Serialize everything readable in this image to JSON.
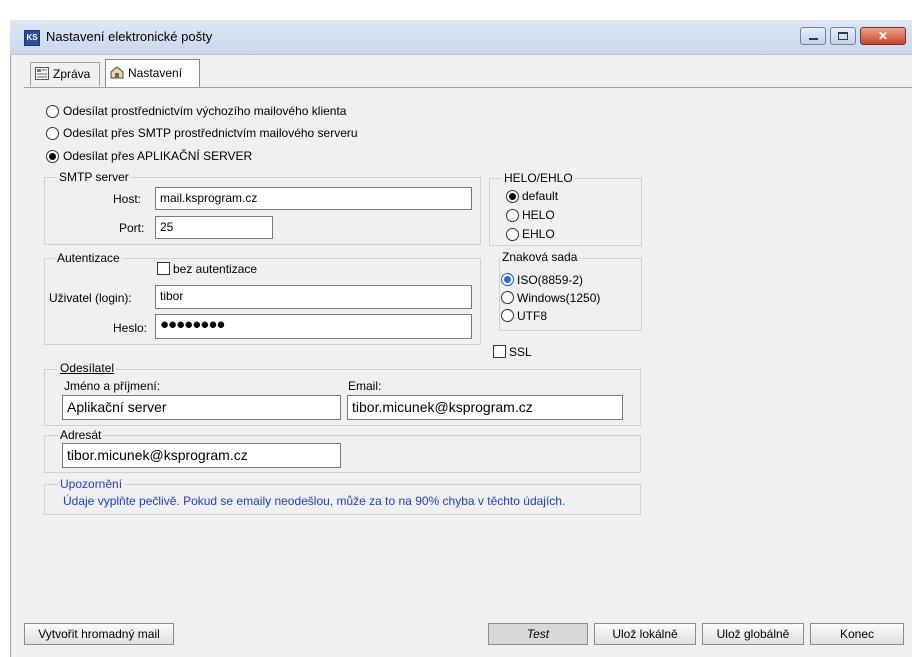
{
  "window": {
    "title": "Nastavení elektronické pošty",
    "icon": "app-icon",
    "controls": [
      "minimize",
      "maximize",
      "close"
    ]
  },
  "tabs": [
    {
      "label": "Zpráva",
      "icon": "message-icon",
      "active": false
    },
    {
      "label": "Nastavení",
      "icon": "settings-icon",
      "active": true
    }
  ],
  "send_mode": {
    "options": [
      {
        "label": "Odesílat prostřednictvím výchozího mailového klienta",
        "selected": false
      },
      {
        "label": "Odesílat přes SMTP prostřednictvím mailového serveru",
        "selected": false
      },
      {
        "label": "Odesílat přes APLIKAČNÍ SERVER",
        "selected": true
      }
    ]
  },
  "smtp": {
    "group_title": "SMTP server",
    "host_label": "Host:",
    "host_value": "mail.ksprogram.cz",
    "port_label": "Port:",
    "port_value": "25"
  },
  "helo": {
    "group_title": "HELO/EHLO",
    "options": [
      {
        "label": "default",
        "selected": true
      },
      {
        "label": "HELO",
        "selected": false
      },
      {
        "label": "EHLO",
        "selected": false
      }
    ]
  },
  "auth": {
    "group_title": "Autentizace",
    "no_auth_label": "bez autentizace",
    "no_auth_checked": false,
    "user_label": "Uživatel (login):",
    "user_value": "tibor",
    "password_label": "Heslo:",
    "password_value": "●●●●●●●●"
  },
  "charset": {
    "group_title": "Znaková sada",
    "options": [
      {
        "label": "ISO(8859-2)",
        "selected": true
      },
      {
        "label": "Windows(1250)",
        "selected": false
      },
      {
        "label": "UTF8",
        "selected": false
      }
    ]
  },
  "ssl": {
    "label": "SSL",
    "checked": false
  },
  "sender": {
    "group_title": "Odesílatel",
    "name_label": "Jméno a příjmení:",
    "name_value": "Aplikační server",
    "email_label": "Email:",
    "email_value": "tibor.micunek@ksprogram.cz"
  },
  "recipient": {
    "group_title": "Adresát",
    "value": "tibor.micunek@ksprogram.cz"
  },
  "notice": {
    "title": "Upozornění",
    "text": "Údaje vyplňte pečlivě. Pokud se emaily neodešlou, může za to na 90% chyba v těchto údajích."
  },
  "buttons": {
    "bulk_mail": "Vytvořit hromadný mail",
    "test": "Test",
    "save_local": "Ulož lokálně",
    "save_global": "Ulož globálně",
    "close": "Konec"
  },
  "colors": {
    "accent_blue": "#1a3fd0",
    "window_bg": "#f0f0f0",
    "close_button": "#c8452b"
  }
}
